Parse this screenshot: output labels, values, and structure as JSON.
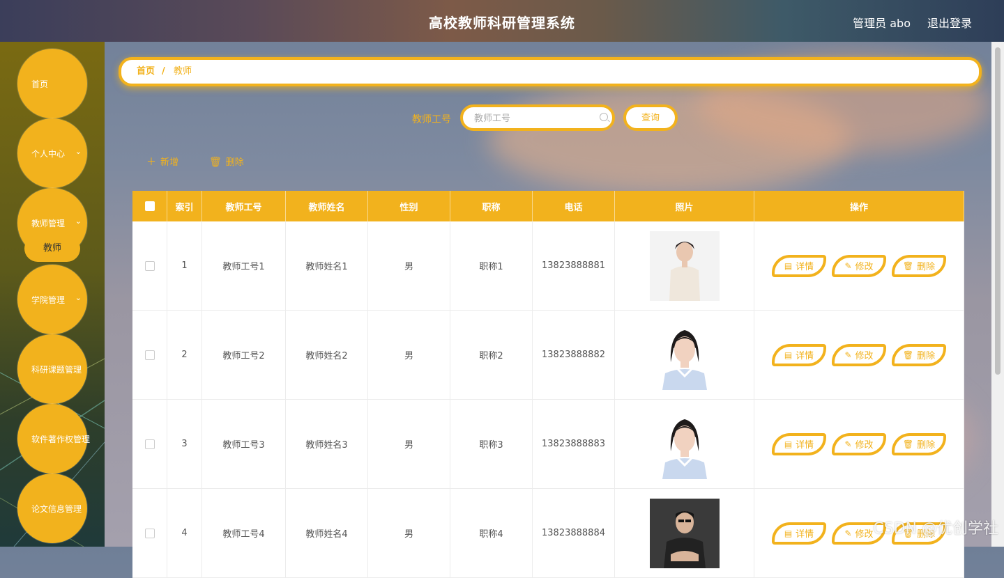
{
  "header": {
    "title": "高校教师科研管理系统",
    "user": "管理员 abo",
    "logout": "退出登录"
  },
  "sidebar": {
    "items": [
      {
        "label": "首页",
        "has_chevron": false
      },
      {
        "label": "个人中心",
        "has_chevron": true
      },
      {
        "label": "教师管理",
        "has_chevron": true
      },
      {
        "label": "学院管理",
        "has_chevron": true
      },
      {
        "label": "科研课题管理",
        "has_chevron": false
      },
      {
        "label": "软件著作权管理",
        "has_chevron": false
      },
      {
        "label": "论文信息管理",
        "has_chevron": false
      }
    ],
    "sub_item": "教师"
  },
  "breadcrumb": {
    "home": "首页",
    "separator": "/",
    "current": "教师"
  },
  "search": {
    "label": "教师工号",
    "placeholder": "教师工号",
    "button": "查询"
  },
  "actions": {
    "add": "新增",
    "delete": "删除"
  },
  "table": {
    "headers": [
      "索引",
      "教师工号",
      "教师姓名",
      "性别",
      "职称",
      "电话",
      "照片",
      "操作"
    ],
    "ops": {
      "detail": "详情",
      "edit": "修改",
      "delete": "删除"
    },
    "rows": [
      {
        "index": "1",
        "id": "教师工号1",
        "name": "教师姓名1",
        "gender": "男",
        "title": "职称1",
        "phone": "13823888881",
        "photo": "woman-white-bg"
      },
      {
        "index": "2",
        "id": "教师工号2",
        "name": "教师姓名2",
        "gender": "男",
        "title": "职称2",
        "phone": "13823888882",
        "photo": "woman-id-photo"
      },
      {
        "index": "3",
        "id": "教师工号3",
        "name": "教师姓名3",
        "gender": "男",
        "title": "职称3",
        "phone": "13823888883",
        "photo": "woman-id-photo"
      },
      {
        "index": "4",
        "id": "教师工号4",
        "name": "教师姓名4",
        "gender": "男",
        "title": "职称4",
        "phone": "13823888884",
        "photo": "man-dark-bg"
      }
    ]
  },
  "watermark": "CSDN @优创学社",
  "colors": {
    "accent": "#f2b21d",
    "header_text": "#ffffff"
  }
}
